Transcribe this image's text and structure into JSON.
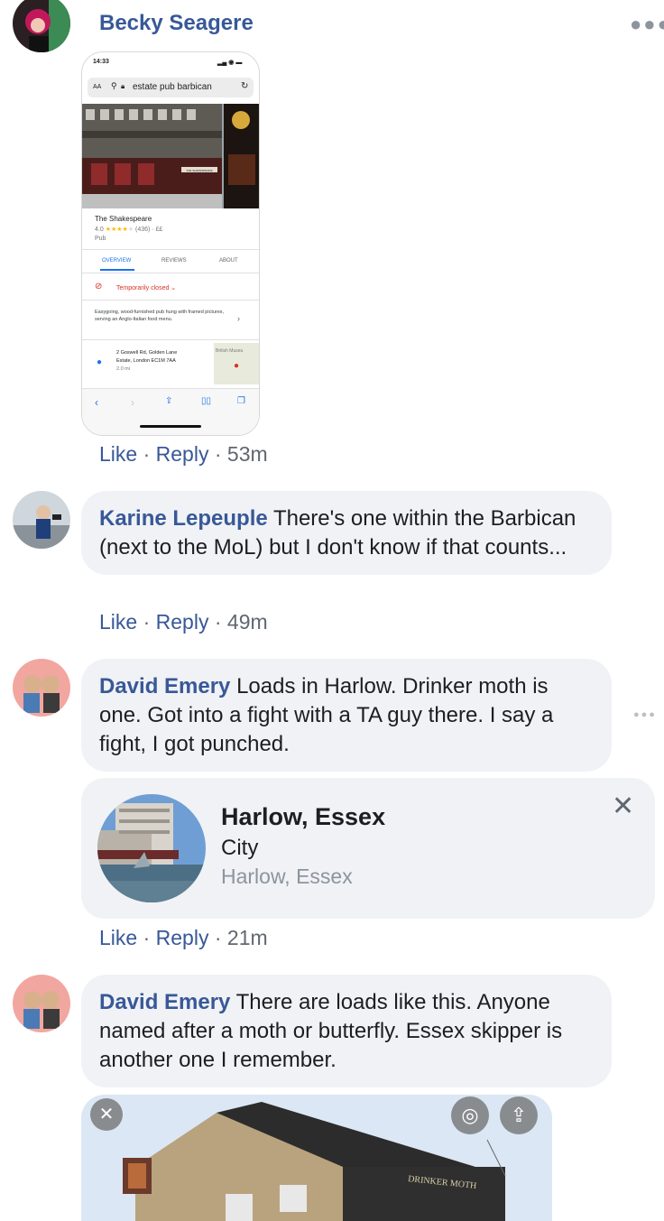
{
  "comments": [
    {
      "author": "Becky Seagere",
      "actions": {
        "like": "Like",
        "reply": "Reply",
        "time": "53m"
      },
      "attachment": {
        "status_time": "14:33",
        "url_bar": "estate pub barbican",
        "url_prefix": "AA",
        "place_name": "The Shakespeare",
        "rating": "4.0",
        "rating_count": "(436)",
        "price": "££",
        "category": "Pub",
        "tabs": [
          "OVERVIEW",
          "REVIEWS",
          "ABOUT"
        ],
        "closed_label": "Temporarily closed",
        "description": "Easygoing, wood-furnished pub hung with framed pictures, serving an Anglo-Italian food menu.",
        "address_line1": "2 Goswell Rd, Golden Lane",
        "address_line2": "Estate, London EC1M 7AA",
        "distance": "2.0 mi",
        "map_label": "British Museu",
        "sign_text": "THE SHAKESPEARE"
      }
    },
    {
      "author": "Karine Lepeuple",
      "text": "There's one within the Barbican (next to the MoL) but I don't know if that counts...",
      "actions": {
        "like": "Like",
        "reply": "Reply",
        "time": "49m"
      }
    },
    {
      "author": "David Emery",
      "text": "Loads in Harlow. Drinker moth is one. Got into a fight with a TA guy there. I say a fight, I got punched.",
      "place_card": {
        "title": "Harlow, Essex",
        "type": "City",
        "subtitle": "Harlow, Essex"
      },
      "actions": {
        "like": "Like",
        "reply": "Reply",
        "time": "21m"
      }
    },
    {
      "author": "David Emery",
      "text": "There are loads like this. Anyone named after a moth or butterfly. Essex skipper is another one I remember.",
      "photo": {
        "sign_text": "DRINKER MOTH"
      }
    }
  ],
  "colors": {
    "link": "#385898",
    "bubble": "#f0f2f5",
    "muted": "#606770"
  }
}
